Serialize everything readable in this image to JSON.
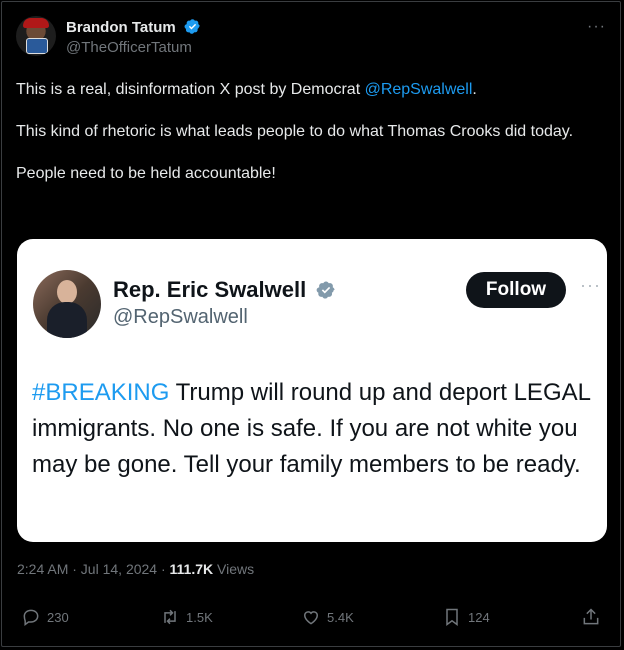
{
  "author": {
    "name": "Brandon Tatum",
    "handle": "@TheOfficerTatum"
  },
  "post": {
    "text_line1_prefix": "This is a real, disinformation X post by Democrat ",
    "text_line1_mention": "@RepSwalwell",
    "text_line1_suffix": ".",
    "text_para2": "This kind of rhetoric is what leads people to do what Thomas Crooks did today.",
    "text_para3": "People need to be held accountable!"
  },
  "embedded": {
    "name": "Rep. Eric Swalwell",
    "handle": "@RepSwalwell",
    "follow_label": "Follow",
    "hashtag": "#BREAKING",
    "text": " Trump will round up and deport LEGAL immigrants. No one is safe. If you are not white you may be gone. Tell your family members  to be ready."
  },
  "meta": {
    "time": "2:24 AM · Jul 14, 2024 · ",
    "views_count": "111.7K",
    "views_label": " Views"
  },
  "actions": {
    "replies": "230",
    "reposts": "1.5K",
    "likes": "5.4K",
    "bookmarks": "124"
  },
  "colors": {
    "accent": "#1d9bf0",
    "background": "#000000",
    "muted": "#71767b"
  }
}
